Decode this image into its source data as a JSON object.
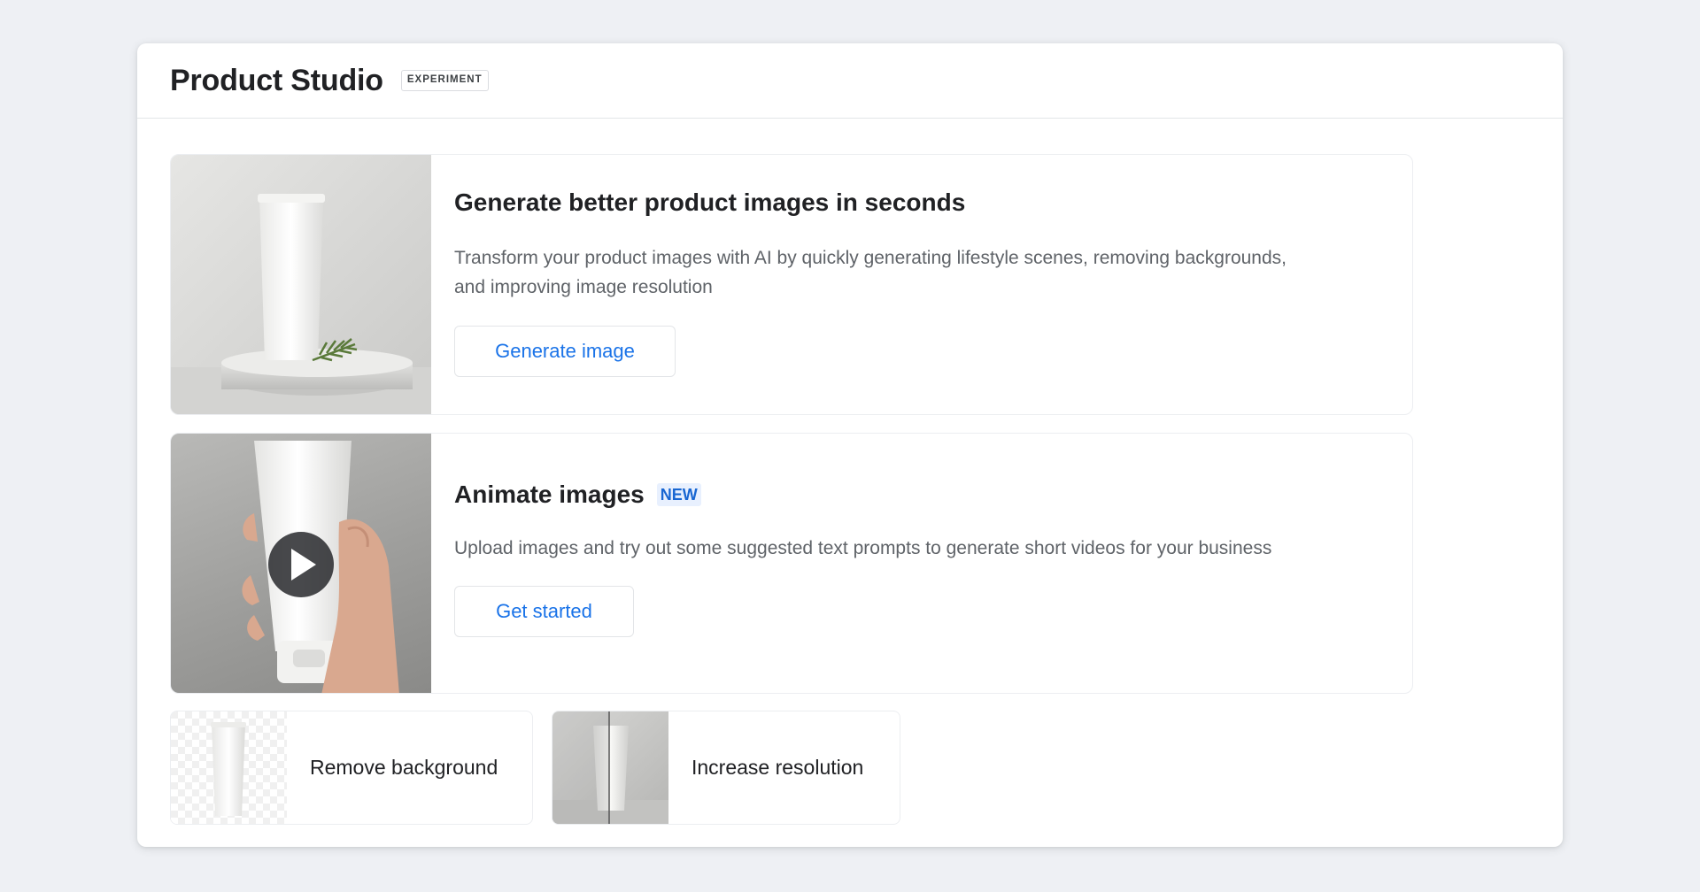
{
  "header": {
    "title": "Product Studio",
    "badge": "EXPERIMENT"
  },
  "features": [
    {
      "title": "Generate better product images in seconds",
      "description": "Transform your product images with AI by quickly generating lifestyle scenes, removing backgrounds, and improving image resolution",
      "button_label": "Generate image"
    },
    {
      "title": "Animate images",
      "badge": "NEW",
      "description": "Upload images and try out some suggested text prompts to generate short videos for your business",
      "button_label": "Get started"
    }
  ],
  "tools": [
    {
      "label": "Remove background"
    },
    {
      "label": "Increase resolution"
    }
  ],
  "colors": {
    "accent": "#1a73e8",
    "new_badge_bg": "#e8f0fe",
    "page_bg": "#eef0f4"
  },
  "icons": {
    "play": "play-icon"
  }
}
